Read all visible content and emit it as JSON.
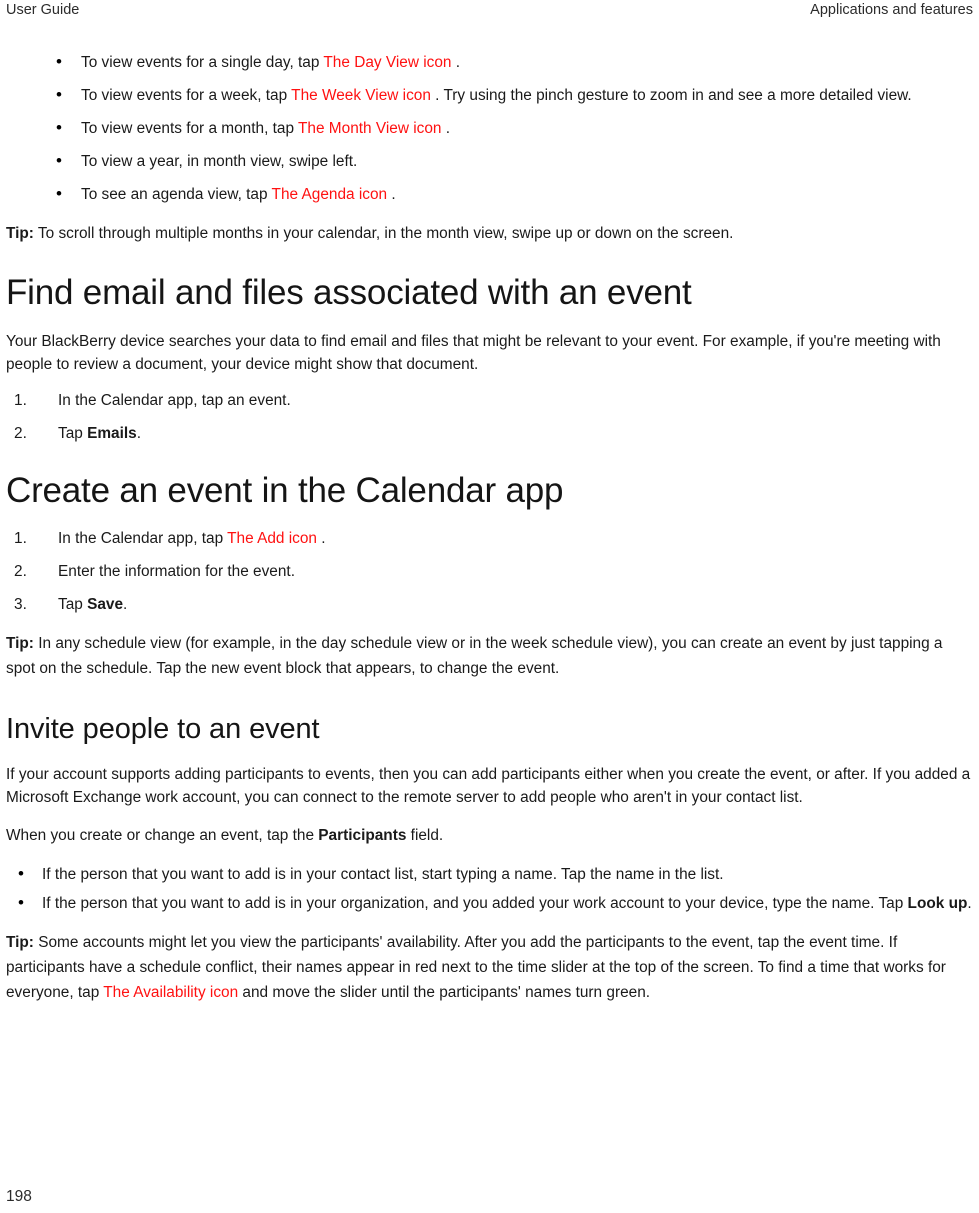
{
  "header": {
    "left": "User Guide",
    "right": "Applications and features"
  },
  "footer": {
    "page_number": "198"
  },
  "colors": {
    "icon_reference_red": "#ff1111",
    "body_text": "#1a1a1a",
    "heading_text": "#151515"
  },
  "calendar_views": {
    "bullets": [
      {
        "pre": "To view events for a single day, tap ",
        "icon": "The Day View icon",
        "post": " ."
      },
      {
        "pre": "To view events for a week, tap ",
        "icon": "The Week View icon",
        "post": " . Try using the pinch gesture to zoom in and see a more detailed view."
      },
      {
        "pre": "To view events for a month, tap ",
        "icon": "The Month View icon",
        "post": " ."
      },
      {
        "pre": " To view a year, in month view, swipe left.",
        "icon": "",
        "post": ""
      },
      {
        "pre": "To see an agenda view, tap ",
        "icon": "The Agenda icon",
        "post": " ."
      }
    ],
    "tip_label": "Tip:",
    "tip_text": " To scroll through multiple months in your calendar, in the month view, swipe up or down on the screen."
  },
  "find_email": {
    "heading": "Find email and files associated with an event",
    "intro": "Your BlackBerry device searches your data to find email and files that might be relevant to your event. For example, if you're meeting with people to review a document, your device might show that document.",
    "steps": [
      {
        "pre": "In the Calendar app, tap an event.",
        "bold": "",
        "post": ""
      },
      {
        "pre": "Tap ",
        "bold": "Emails",
        "post": "."
      }
    ]
  },
  "create_event": {
    "heading": "Create an event in the Calendar app",
    "steps": [
      {
        "pre": "In the Calendar app, tap ",
        "icon": "The Add icon",
        "post": " .",
        "bold": ""
      },
      {
        "pre": "Enter the information for the event.",
        "icon": "",
        "post": "",
        "bold": ""
      },
      {
        "pre": "Tap ",
        "icon": "",
        "bold": "Save",
        "post": "."
      }
    ],
    "tip_label": "Tip:",
    "tip_text": " In any schedule view (for example, in the day schedule view or in the week schedule view), you can create an event by just tapping a spot on the schedule. Tap the new event block that appears, to change the event."
  },
  "invite_people": {
    "heading": "Invite people to an event",
    "intro": "If your account supports adding participants to events, then you can add participants either when you create the event, or after. If you added a Microsoft Exchange work account, you can connect to the remote server to add people who aren't in your contact list.",
    "lead_pre": "When you create or change an event, tap the ",
    "lead_bold": "Participants",
    "lead_post": " field.",
    "bullets": [
      {
        "pre": "If the person that you want to add is in your contact list, start typing a name. Tap the name in the list.",
        "bold": "",
        "post": ""
      },
      {
        "pre": "If the person that you want to add is in your organization, and you added your work account to your device, type the name. Tap ",
        "bold": "Look up",
        "post": "."
      }
    ],
    "tip_label": "Tip:",
    "tip_pre": " Some accounts might let you view the participants' availability. After you add the participants to the event, tap the event time. If participants have a schedule conflict, their names appear in red next to the time slider at the top of the screen. To find a time that works for everyone, tap ",
    "tip_icon": "The Availability icon",
    "tip_post": " and move the slider until the participants' names turn green."
  }
}
